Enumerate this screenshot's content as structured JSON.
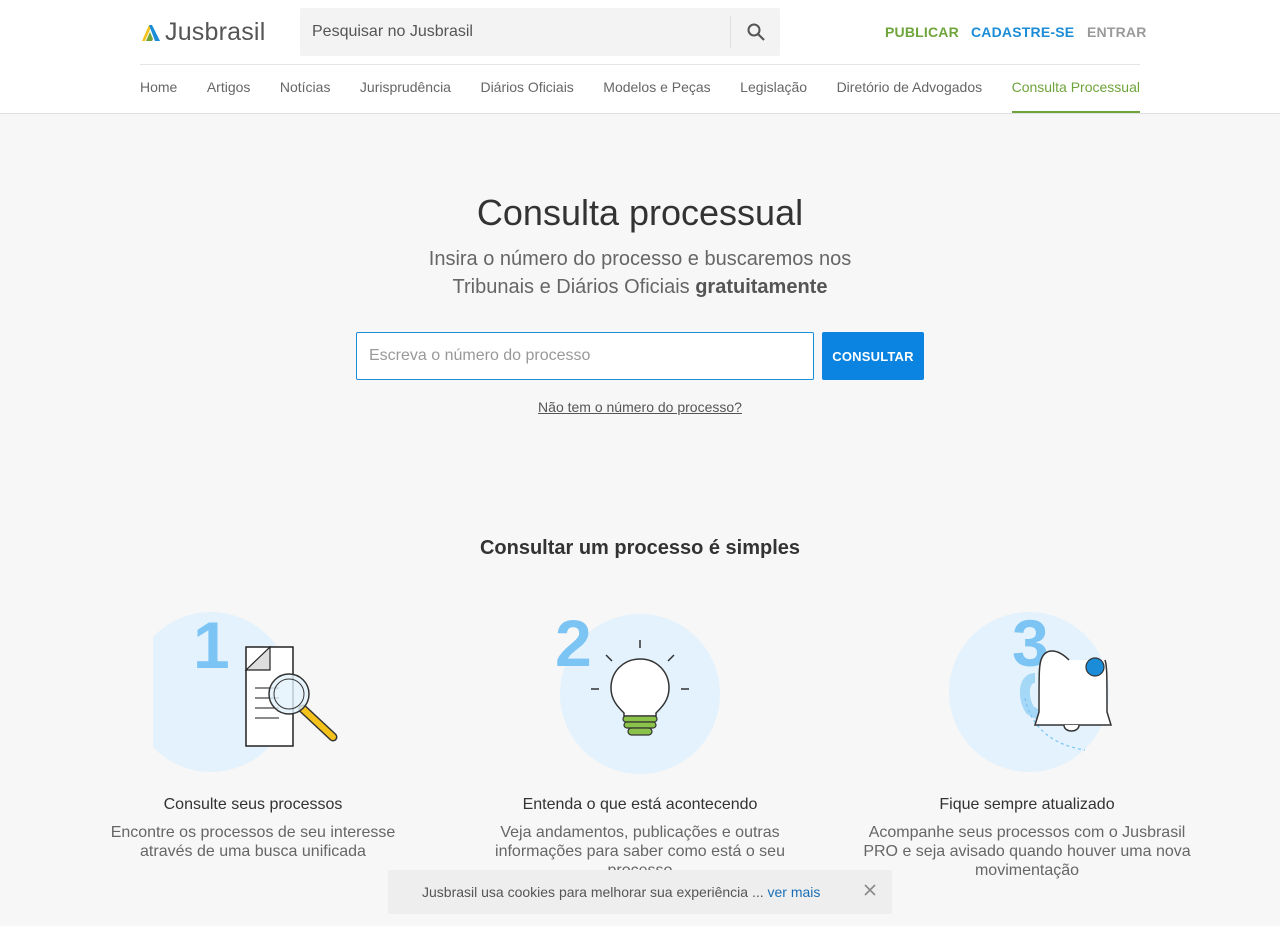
{
  "brand": {
    "name": "Jusbrasil"
  },
  "search": {
    "placeholder": "Pesquisar no Jusbrasil",
    "icon": "search-icon"
  },
  "auth": {
    "publicar": "PUBLICAR",
    "cadastre": "CADASTRE-SE",
    "entrar": "ENTRAR"
  },
  "nav": {
    "items": [
      {
        "label": "Home"
      },
      {
        "label": "Artigos"
      },
      {
        "label": "Notícias"
      },
      {
        "label": "Jurisprudência"
      },
      {
        "label": "Diários Oficiais"
      },
      {
        "label": "Modelos e Peças"
      },
      {
        "label": "Legislação"
      },
      {
        "label": "Diretório de Advogados"
      },
      {
        "label": "Consulta Processual"
      }
    ],
    "active": "Consulta Processual"
  },
  "hero": {
    "title": "Consulta processual",
    "subtitle_line1": "Insira o número do processo e buscaremos nos",
    "subtitle_line2": "Tribunais e Diários Oficiais",
    "subtitle_bold": "gratuitamente",
    "input_placeholder": "Escreva o número do processo",
    "button_label": "CONSULTAR",
    "no_number_link": "Não tem o número do processo?"
  },
  "steps": {
    "title": "Consultar um processo é simples",
    "items": [
      {
        "number": "1",
        "icon": "document-search-icon",
        "heading": "Consulte seus processos",
        "description": "Encontre os processos de seu interesse através de uma busca unificada"
      },
      {
        "number": "2",
        "icon": "lightbulb-icon",
        "heading": "Entenda o que está acontecendo",
        "description": "Veja andamentos, publicações e outras informações para saber como está o seu processo"
      },
      {
        "number": "3",
        "icon": "bell-icon",
        "heading": "Fique sempre atualizado",
        "description": "Acompanhe seus processos com o Jusbrasil PRO e seja avisado quando houver uma nova movimentação"
      }
    ]
  },
  "cookie": {
    "text": "Jusbrasil usa cookies para melhorar sua experiência ...",
    "link": "ver mais",
    "close_icon": "close-icon"
  },
  "colors": {
    "green": "#6fa43b",
    "blue": "#0a84e0",
    "light_blue": "#e3f2fc",
    "number_blue": "#7cc4f4",
    "yellow": "#f5c21b"
  }
}
